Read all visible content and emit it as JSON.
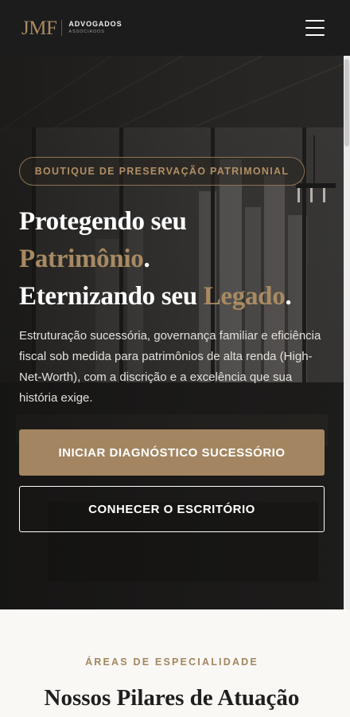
{
  "header": {
    "logo_mark": "JMF",
    "logo_name": "ADVOGADOS",
    "logo_sub": "ASSOCIADOS",
    "menu_icon": "hamburger-menu-icon"
  },
  "hero": {
    "badge": "BOUTIQUE DE PRESERVAÇÃO PATRIMONIAL",
    "headline": {
      "line1": "Protegendo seu",
      "line2_gold": "Patrimônio",
      "line2_dot": ".",
      "line3_a": "Eternizando seu ",
      "line3_gold": "Legado",
      "line3_dot": "."
    },
    "description": "Estruturação sucessória, governança familiar e eficiência fiscal sob medida para patrimônios de alta renda (High-Net-Worth), com a discrição e a excelência que sua história exige.",
    "primary_button": "INICIAR DIAGNÓSTICO SUCESSÓRIO",
    "secondary_button": "CONHECER O ESCRITÓRIO"
  },
  "section": {
    "kicker": "ÁREAS DE ESPECIALIDADE",
    "title": "Nossos Pilares de Atuação"
  },
  "colors": {
    "accent": "#a38661",
    "header_bg": "#1c1c1c",
    "section_bg": "#faf8f4"
  }
}
